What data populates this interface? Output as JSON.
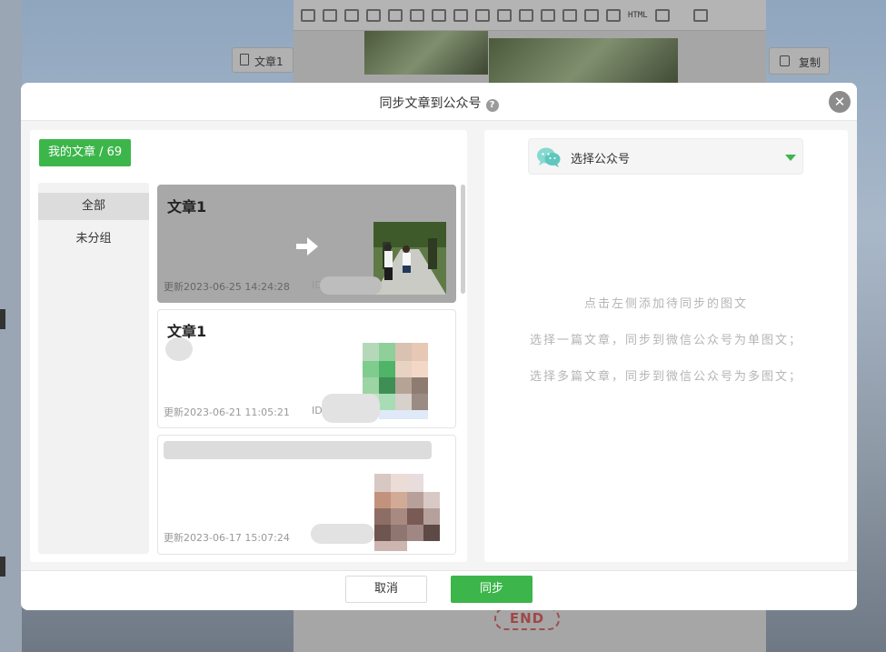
{
  "background": {
    "tab_label": "文章1",
    "copy_label": "复制",
    "html_label": "HTML",
    "end_label": "END"
  },
  "modal": {
    "title": "同步文章到公众号",
    "help_icon": "question-circle-icon",
    "close_icon": "close-icon"
  },
  "left": {
    "my_articles_label": "我的文章 / 69",
    "groups": [
      {
        "label": "全部",
        "active": true
      },
      {
        "label": "未分组",
        "active": false
      }
    ],
    "articles": [
      {
        "title": "文章1",
        "updated": "更新2023-06-25 14:24:28",
        "id_label": "ID",
        "selected": true
      },
      {
        "title": "文章1",
        "updated": "更新2023-06-21 11:05:21",
        "id_label": "ID",
        "selected": false
      },
      {
        "title": "",
        "updated": "更新2023-06-17 15:07:24",
        "id_label": "",
        "selected": false
      }
    ]
  },
  "right": {
    "select_placeholder": "选择公众号",
    "hints": [
      "点击左侧添加待同步的图文",
      "选择一篇文章，同步到微信公众号为单图文；",
      "选择多篇文章，同步到微信公众号为多图文；"
    ]
  },
  "footer": {
    "cancel_label": "取消",
    "sync_label": "同步"
  },
  "colors": {
    "accent": "#3cb64a",
    "selected_card": "#a8a8a8",
    "hint_text": "#b5b5b5"
  }
}
